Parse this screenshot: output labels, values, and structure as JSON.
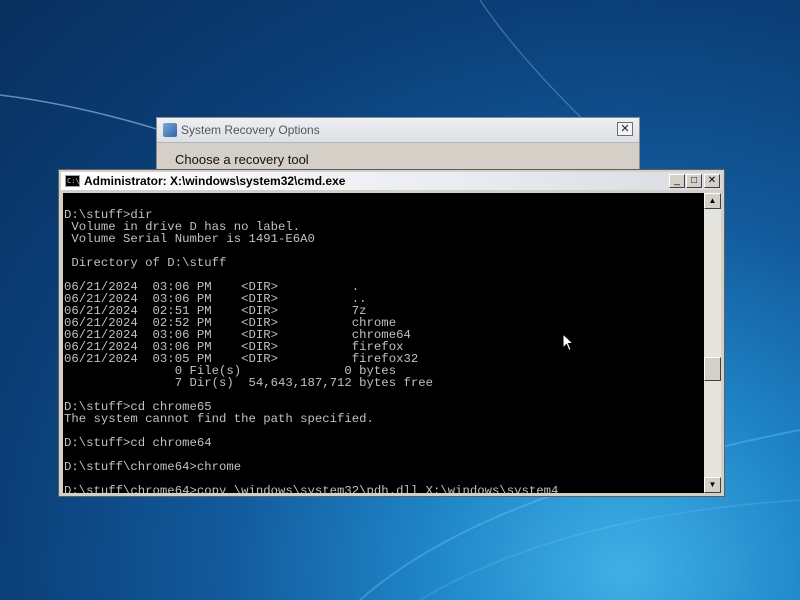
{
  "recovery_window": {
    "title": "System Recovery Options",
    "heading": "Choose a recovery tool",
    "close_label": "✕"
  },
  "cmd_window": {
    "title": "Administrator: X:\\windows\\system32\\cmd.exe",
    "icon_text": "C:\\",
    "minimize_label": "_",
    "maximize_label": "□",
    "close_label": "✕",
    "lines": [
      "",
      "D:\\stuff>dir",
      " Volume in drive D has no label.",
      " Volume Serial Number is 1491-E6A0",
      "",
      " Directory of D:\\stuff",
      "",
      "06/21/2024  03:06 PM    <DIR>          .",
      "06/21/2024  03:06 PM    <DIR>          ..",
      "06/21/2024  02:51 PM    <DIR>          7z",
      "06/21/2024  02:52 PM    <DIR>          chrome",
      "06/21/2024  03:06 PM    <DIR>          chrome64",
      "06/21/2024  03:06 PM    <DIR>          firefox",
      "06/21/2024  03:05 PM    <DIR>          firefox32",
      "               0 File(s)              0 bytes",
      "               7 Dir(s)  54,643,187,712 bytes free",
      "",
      "D:\\stuff>cd chrome65",
      "The system cannot find the path specified.",
      "",
      "D:\\stuff>cd chrome64",
      "",
      "D:\\stuff\\chrome64>chrome",
      "",
      "D:\\stuff\\chrome64>copy \\windows\\system32\\pdh.dll X:\\windows\\system4"
    ],
    "scroll_up": "▲",
    "scroll_down": "▼"
  }
}
